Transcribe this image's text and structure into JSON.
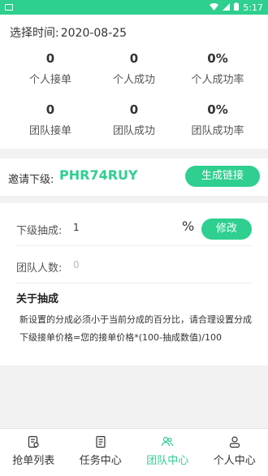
{
  "status_bar": {
    "time": "5:17"
  },
  "stats": {
    "date_label": "选择时间:",
    "date_value": "2020-08-25",
    "personal": [
      {
        "value": "0",
        "label": "个人接单"
      },
      {
        "value": "0",
        "label": "个人成功"
      },
      {
        "value": "0%",
        "label": "个人成功率"
      }
    ],
    "team": [
      {
        "value": "0",
        "label": "团队接单"
      },
      {
        "value": "0",
        "label": "团队成功"
      },
      {
        "value": "0%",
        "label": "团队成功率"
      }
    ]
  },
  "invite": {
    "label": "邀请下级:",
    "code": "PHR74RUY",
    "generate_button": "生成链接"
  },
  "config": {
    "commission_label": "下级抽成:",
    "commission_value": "1",
    "percent_sign": "%",
    "modify_button": "修改",
    "team_count_label": "团队人数:",
    "team_count_value": "0",
    "about_title": "关于抽成",
    "about_line1": "新设置的分成必须小于当前分成的百分比，请合理设置分成",
    "about_line2": "下级接单价格=您的接单价格*(100-抽成数值)/100"
  },
  "tabbar": {
    "items": [
      {
        "label": "抢单列表",
        "icon": "order-list-icon",
        "active": false
      },
      {
        "label": "任务中心",
        "icon": "task-document-icon",
        "active": false
      },
      {
        "label": "团队中心",
        "icon": "team-icon",
        "active": true
      },
      {
        "label": "个人中心",
        "icon": "person-icon",
        "active": false
      }
    ]
  },
  "colors": {
    "accent": "#2ecf8f"
  }
}
